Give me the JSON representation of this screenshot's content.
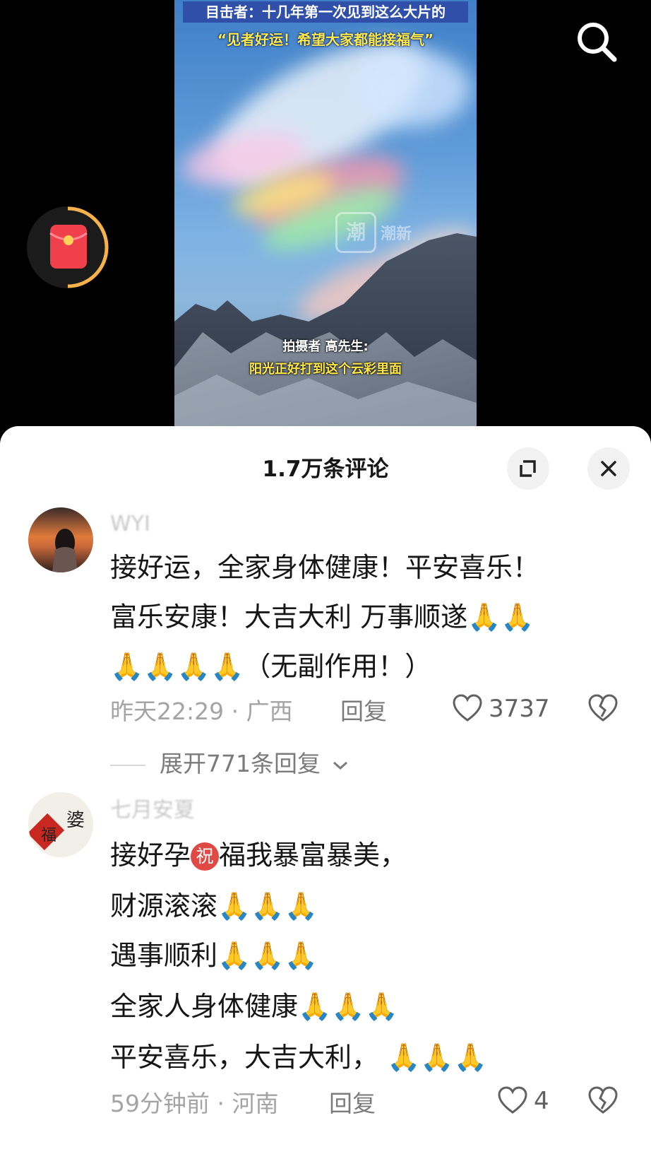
{
  "video": {
    "caption_line1": "目击者：十几年第一次见到这么大片的",
    "caption_line2": "“见者好运！希望大家都能接福气”",
    "subtitle_speaker": "拍摄者 高先生:",
    "subtitle_text": "阳光正好打到这个云彩里面",
    "watermark_glyph": "潮",
    "watermark_text": "潮新",
    "icons": [
      "search-icon",
      "red-packet-icon"
    ]
  },
  "comments_sheet": {
    "title": "1.7万条评论",
    "icons": [
      "expand-icon",
      "close-icon"
    ],
    "comments": [
      {
        "username": "WYI",
        "lines": [
          "接好运，全家身体健康！平安喜乐！",
          "富乐安康！大吉大利 万事顺遂🙏🙏",
          "🙏🙏🙏🙏（无副作用！）"
        ],
        "time": "昨天22:29 · 广西",
        "reply_label": "回复",
        "likes": "3737",
        "expand_replies": "展开771条回复"
      },
      {
        "username": "七月安夏",
        "avatar_chars": [
          "福",
          "婆"
        ],
        "lines_prefix": "接好孕",
        "badge": "祝",
        "lines_suffix": "福我暴富暴美，",
        "lines": [
          "财源滚滚🙏🙏🙏",
          "遇事顺利🙏🙏🙏",
          "全家人身体健康🙏🙏🙏",
          "平安喜乐，大吉大利，  🙏🙏🙏"
        ],
        "time": "59分钟前 · 河南",
        "reply_label": "回复",
        "likes": "4"
      }
    ]
  }
}
